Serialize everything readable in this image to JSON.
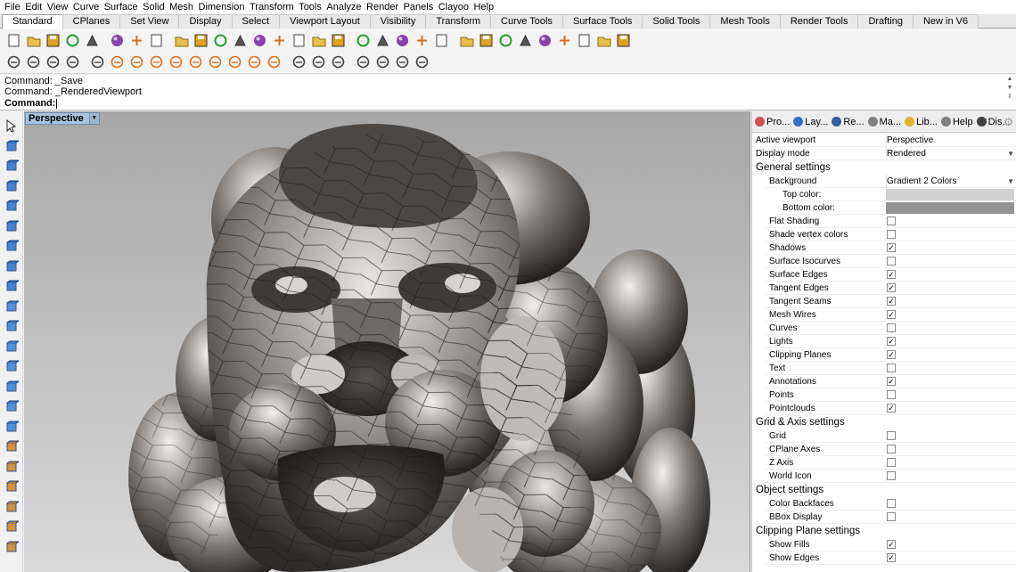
{
  "menu": [
    "File",
    "Edit",
    "View",
    "Curve",
    "Surface",
    "Solid",
    "Mesh",
    "Dimension",
    "Transform",
    "Tools",
    "Analyze",
    "Render",
    "Panels",
    "Clayoo",
    "Help"
  ],
  "tabs": [
    {
      "label": "Standard",
      "active": true
    },
    {
      "label": "CPlanes",
      "active": false
    },
    {
      "label": "Set View",
      "active": false
    },
    {
      "label": "Display",
      "active": false
    },
    {
      "label": "Select",
      "active": false
    },
    {
      "label": "Viewport Layout",
      "active": false
    },
    {
      "label": "Visibility",
      "active": false
    },
    {
      "label": "Transform",
      "active": false
    },
    {
      "label": "Curve Tools",
      "active": false
    },
    {
      "label": "Surface Tools",
      "active": false
    },
    {
      "label": "Solid Tools",
      "active": false
    },
    {
      "label": "Mesh Tools",
      "active": false
    },
    {
      "label": "Render Tools",
      "active": false
    },
    {
      "label": "Drafting",
      "active": false
    },
    {
      "label": "New in V6",
      "active": false
    }
  ],
  "toolbar_icons": [
    "new-file-icon",
    "open-icon",
    "save-icon",
    "print-icon",
    "import-icon",
    "cut-icon",
    "copy-icon",
    "paste-icon",
    "undo-icon",
    "pan-icon",
    "move-view-icon",
    "zoom-icon",
    "zoom-window-icon",
    "zoom-extents-icon",
    "zoom-selected-icon",
    "rotate-view-icon",
    "four-view-icon",
    "car-icon",
    "ghost-icon",
    "snap-icon",
    "light-bulb-icon",
    "lock-icon",
    "layer-icon",
    "color-wheel-icon",
    "sphere-icon",
    "shaded-sphere-icon",
    "render-sphere-icon",
    "gears-icon",
    "grid-icon",
    "globe-icon",
    "help-icon"
  ],
  "toolbar2_icons": [
    "check-icon",
    "teapot-icon",
    "cup-icon",
    "monitor-icon",
    "lasso-icon",
    "filter-icon",
    "ring-icon",
    "triangle-icon",
    "tripod-icon",
    "dome-icon",
    "spiral-icon",
    "circle-icon",
    "sun-icon",
    "hatch-icon",
    "car2-icon",
    "box-icon",
    "box2-icon",
    "plant-icon",
    "brush-icon",
    "lamp-icon",
    "target-icon"
  ],
  "command": {
    "line1": "Command: _Save",
    "line2": "Command: _RenderedViewport",
    "prompt": "Command:"
  },
  "viewport": {
    "title": "Perspective"
  },
  "panel_tabs": [
    {
      "label": "Pro...",
      "icon": "properties-icon",
      "color": "#d05050"
    },
    {
      "label": "Lay...",
      "icon": "layers-icon",
      "color": "#3070c0"
    },
    {
      "label": "Re...",
      "icon": "render-icon",
      "color": "#3060a0"
    },
    {
      "label": "Ma...",
      "icon": "materials-icon",
      "color": "#808080"
    },
    {
      "label": "Lib...",
      "icon": "libraries-icon",
      "color": "#e0b030"
    },
    {
      "label": "Help",
      "icon": "help-panel-icon",
      "color": "#808080"
    },
    {
      "label": "Dis...",
      "icon": "display-icon",
      "color": "#404040"
    }
  ],
  "display_panel": {
    "active_viewport_label": "Active viewport",
    "active_viewport_value": "Perspective",
    "display_mode_label": "Display mode",
    "display_mode_value": "Rendered",
    "sections": [
      {
        "title": "General settings",
        "items": [
          {
            "label": "Background",
            "kind": "select",
            "value": "Gradient 2 Colors"
          },
          {
            "label": "Top color:",
            "kind": "color",
            "value": "#d0d0d0",
            "indent": 2
          },
          {
            "label": "Bottom color:",
            "kind": "color",
            "value": "#939393",
            "indent": 2
          },
          {
            "label": "Flat Shading",
            "kind": "check",
            "checked": false
          },
          {
            "label": "Shade vertex colors",
            "kind": "check",
            "checked": false
          },
          {
            "label": "Shadows",
            "kind": "check",
            "checked": true
          },
          {
            "label": "Surface Isocurves",
            "kind": "check",
            "checked": false
          },
          {
            "label": "Surface Edges",
            "kind": "check",
            "checked": true
          },
          {
            "label": "Tangent Edges",
            "kind": "check",
            "checked": true
          },
          {
            "label": "Tangent Seams",
            "kind": "check",
            "checked": true
          },
          {
            "label": "Mesh Wires",
            "kind": "check",
            "checked": true
          },
          {
            "label": "Curves",
            "kind": "check",
            "checked": false
          },
          {
            "label": "Lights",
            "kind": "check",
            "checked": true
          },
          {
            "label": "Clipping Planes",
            "kind": "check",
            "checked": true
          },
          {
            "label": "Text",
            "kind": "check",
            "checked": false
          },
          {
            "label": "Annotations",
            "kind": "check",
            "checked": true
          },
          {
            "label": "Points",
            "kind": "check",
            "checked": false
          },
          {
            "label": "Pointclouds",
            "kind": "check",
            "checked": true
          }
        ]
      },
      {
        "title": "Grid & Axis settings",
        "items": [
          {
            "label": "Grid",
            "kind": "check",
            "checked": false
          },
          {
            "label": "CPlane Axes",
            "kind": "check",
            "checked": false
          },
          {
            "label": "Z Axis",
            "kind": "check",
            "checked": false
          },
          {
            "label": "World Icon",
            "kind": "check",
            "checked": false
          }
        ]
      },
      {
        "title": "Object settings",
        "items": [
          {
            "label": "Color Backfaces",
            "kind": "check",
            "checked": false
          },
          {
            "label": "BBox Display",
            "kind": "check",
            "checked": false
          }
        ]
      },
      {
        "title": "Clipping Plane settings",
        "items": [
          {
            "label": "Show Fills",
            "kind": "check",
            "checked": true
          },
          {
            "label": "Show Edges",
            "kind": "check",
            "checked": true
          }
        ]
      }
    ]
  },
  "left_tools": [
    "select-arrow-icon",
    "point-icon",
    "polyline-icon",
    "rectangle-icon",
    "circle-tool-icon",
    "ellipse-icon",
    "arc-icon",
    "rect2-icon",
    "polygon-icon",
    "curve-icon",
    "surface-icon",
    "extrude-icon",
    "box-solid-icon",
    "boolean-icon",
    "cylinder-icon",
    "plane-icon",
    "gear-solid-icon",
    "dimension-icon",
    "text-icon",
    "transform-icon",
    "mesh-icon",
    "group-icon"
  ],
  "colors": {
    "accent": "#a9c4df",
    "mesh_dark": "#3a3736",
    "mesh_light": "#d8d5d2"
  }
}
